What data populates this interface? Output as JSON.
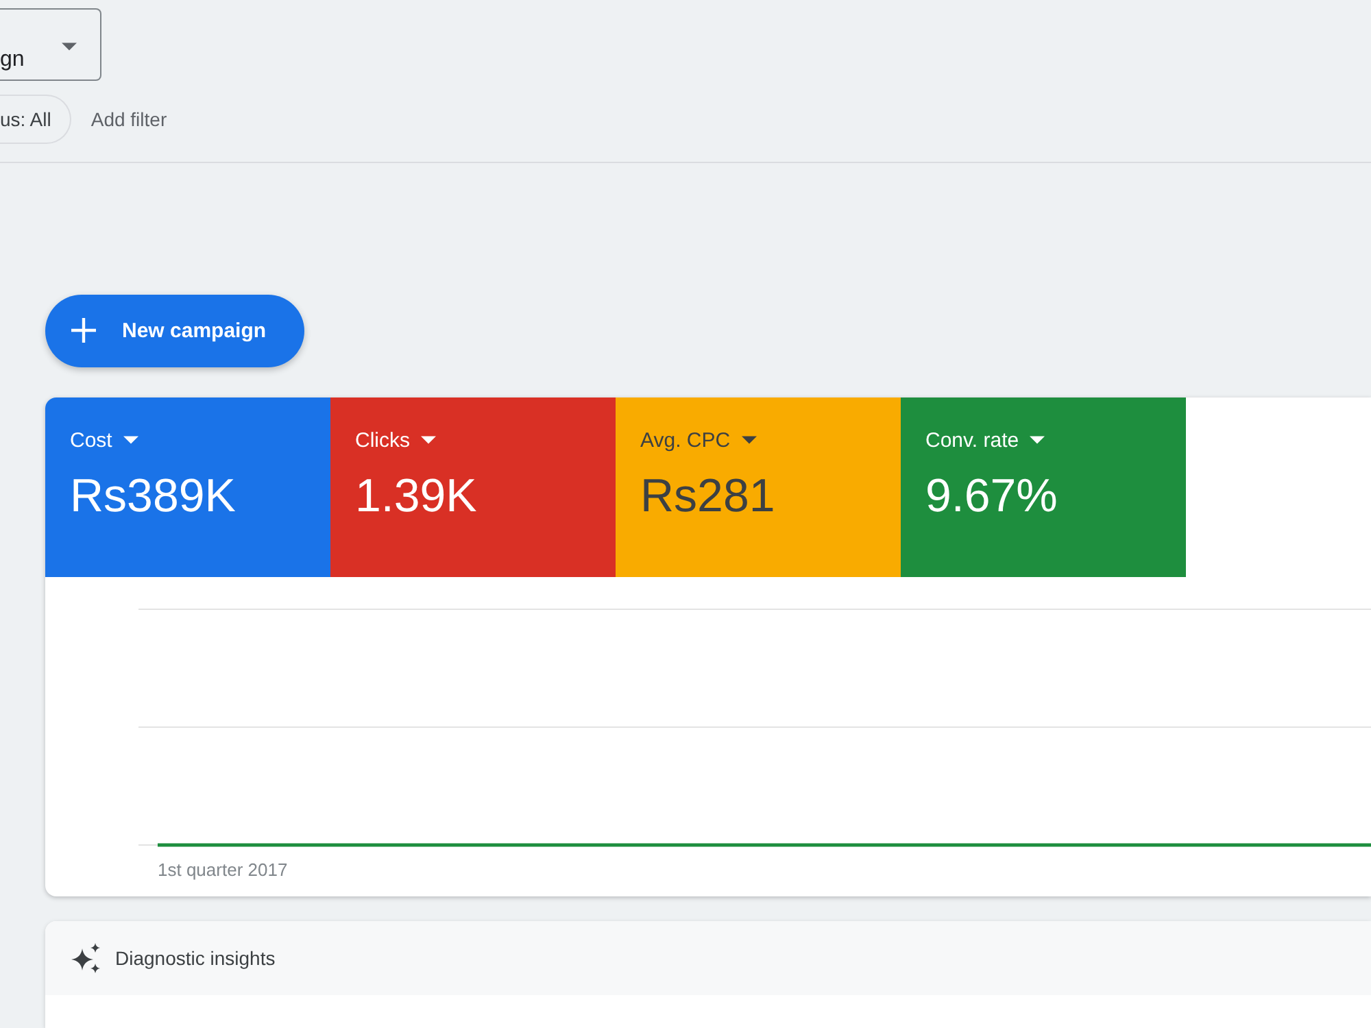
{
  "campaign_select": {
    "value": "gn"
  },
  "filters": {
    "chips": [
      {
        "label": "us: All"
      }
    ],
    "add_label": "Add filter"
  },
  "new_campaign_button": {
    "label": "New campaign"
  },
  "metrics": [
    {
      "label": "Cost",
      "value": "Rs389K",
      "selected": true,
      "color": "#1a73e8"
    },
    {
      "label": "Clicks",
      "value": "1.39K",
      "selected": true,
      "color": "#d93025"
    },
    {
      "label": "Avg. CPC",
      "value": "Rs281",
      "selected": true,
      "color": "#f9ab00"
    },
    {
      "label": "Conv. rate",
      "value": "9.67%",
      "selected": true,
      "color": "#1e8e3e"
    }
  ],
  "chart": {
    "x_label": "1st quarter 2017"
  },
  "insights": {
    "title": "Diagnostic insights"
  }
}
